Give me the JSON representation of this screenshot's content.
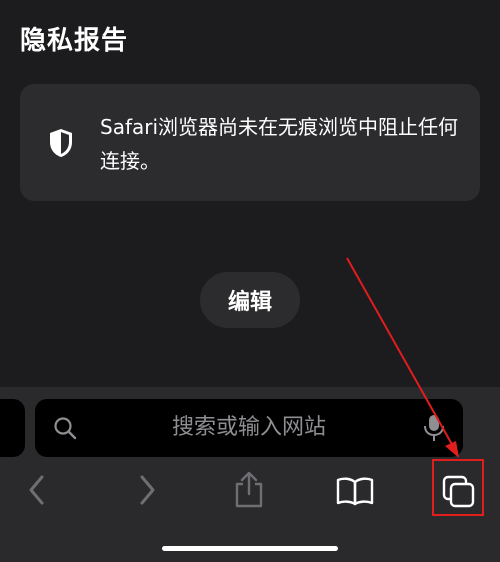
{
  "page": {
    "title": "隐私报告"
  },
  "privacy_card": {
    "message": "Safari浏览器尚未在无痕浏览中阻止任何连接。",
    "icon": "shield-icon"
  },
  "edit_button": {
    "label": "编辑"
  },
  "search": {
    "placeholder": "搜索或输入网站",
    "left_icon": "search-icon",
    "right_icon": "microphone-icon"
  },
  "toolbar": {
    "buttons": [
      {
        "name": "back",
        "icon": "chevron-left-icon"
      },
      {
        "name": "forward",
        "icon": "chevron-right-icon"
      },
      {
        "name": "share",
        "icon": "share-icon"
      },
      {
        "name": "bookmarks",
        "icon": "book-icon"
      },
      {
        "name": "tabs",
        "icon": "tabs-icon"
      }
    ]
  },
  "colors": {
    "background": "#1c1c1e",
    "card": "#2c2c2e",
    "toolbar": "#2a2a2c",
    "annotation": "#e11d1d"
  }
}
